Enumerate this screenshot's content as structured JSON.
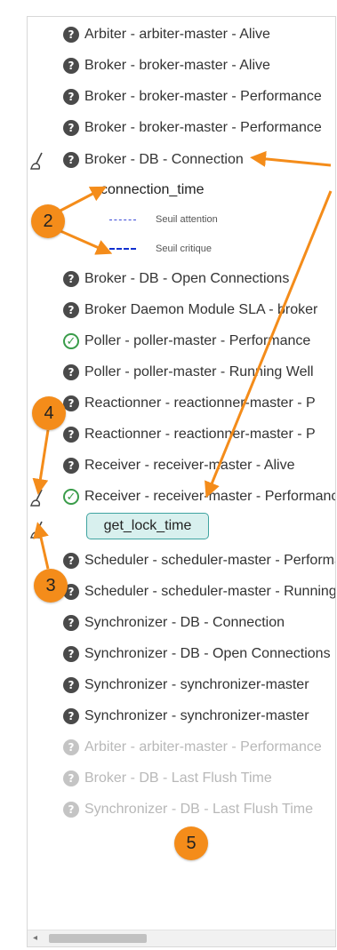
{
  "tree": {
    "items": [
      {
        "label": "Arbiter - arbiter-master - Alive",
        "status": "unknown"
      },
      {
        "label": "Broker - broker-master - Alive",
        "status": "unknown"
      },
      {
        "label": "Broker - broker-master - Performance",
        "status": "unknown"
      },
      {
        "label": "Broker - broker-master - Performance",
        "status": "unknown"
      },
      {
        "label": "Broker - DB - Connection",
        "status": "unknown"
      },
      {
        "label": "Broker - DB - Open Connections",
        "status": "unknown"
      },
      {
        "label": "Broker Daemon Module SLA - broker",
        "status": "unknown"
      },
      {
        "label": "Poller - poller-master - Performance",
        "status": "ok"
      },
      {
        "label": "Poller - poller-master - Running Well",
        "status": "unknown"
      },
      {
        "label": "Reactionner - reactionner-master - P",
        "status": "unknown"
      },
      {
        "label": "Reactionner - reactionner-master - P",
        "status": "unknown"
      },
      {
        "label": "Receiver - receiver-master - Alive",
        "status": "unknown"
      },
      {
        "label": "Receiver - receiver-master - Performance",
        "status": "ok"
      },
      {
        "label": "Scheduler - scheduler-master - Performance",
        "status": "unknown"
      },
      {
        "label": "Scheduler - scheduler-master - Running",
        "status": "unknown"
      },
      {
        "label": "Synchronizer - DB - Connection",
        "status": "unknown"
      },
      {
        "label": "Synchronizer - DB - Open Connections",
        "status": "unknown"
      },
      {
        "label": "Synchronizer - synchronizer-master",
        "status": "unknown"
      },
      {
        "label": "Synchronizer - synchronizer-master",
        "status": "unknown"
      },
      {
        "label": "Arbiter - arbiter-master - Performance",
        "status": "unknown-dim"
      },
      {
        "label": "Broker - DB - Last Flush Time",
        "status": "unknown-dim"
      },
      {
        "label": "Synchronizer - DB - Last Flush Time",
        "status": "unknown-dim"
      }
    ],
    "expanded_metric": "connection_time",
    "legend_attention": "Seuil attention",
    "legend_critique": "Seuil critique",
    "selected_metric": "get_lock_time"
  },
  "icons": {
    "status_unknown": "?",
    "status_ok": "✓",
    "brush": "brush-icon",
    "scroll_left": "◂"
  },
  "annotations": {
    "badge_2": "2",
    "badge_3": "3",
    "badge_4": "4",
    "badge_5": "5"
  },
  "colors": {
    "accent_orange": "#f48c1a",
    "chip_border": "#3fa3a0",
    "chip_bg": "#d8f0ee",
    "ok_green": "#3a9c4a",
    "threshold_blue": "#1030d0"
  }
}
